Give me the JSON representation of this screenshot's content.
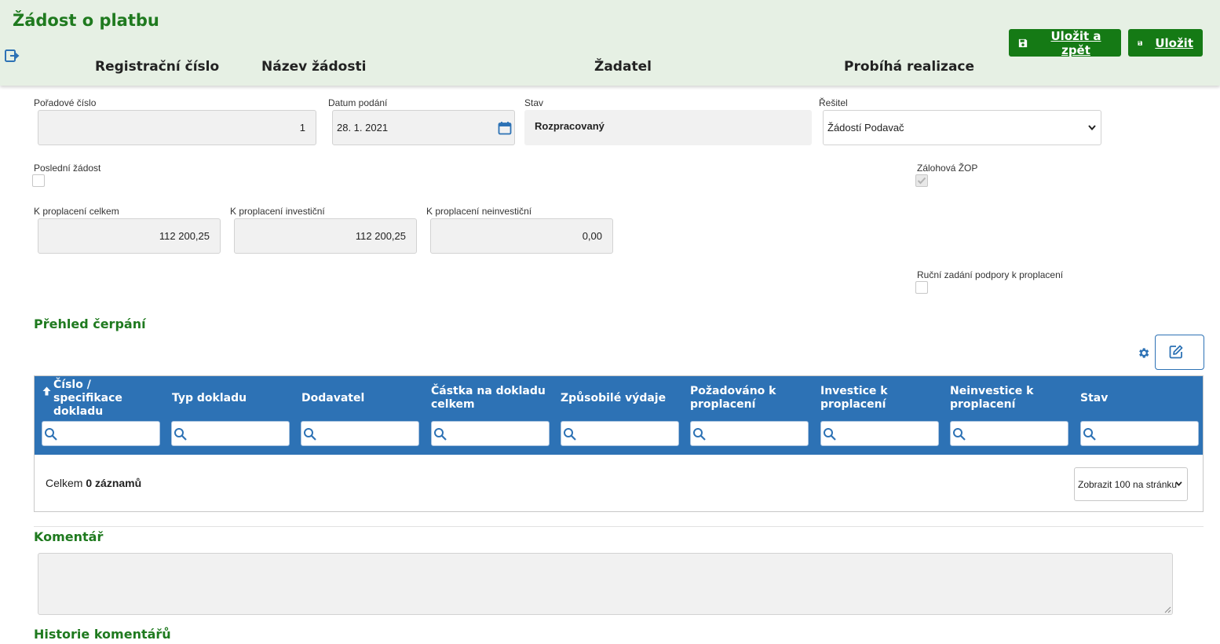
{
  "header": {
    "title": "Žádost o platbu",
    "columns": [
      "Registrační číslo",
      "Název žádosti",
      "Žadatel",
      "Probíhá realizace"
    ],
    "save_back_label": "Uložit a zpět",
    "save_label": "Uložit"
  },
  "form": {
    "poradove_cislo": {
      "label": "Pořadové číslo",
      "value": "1"
    },
    "datum_podani": {
      "label": "Datum podání",
      "value": "28. 1. 2021"
    },
    "stav": {
      "label": "Stav",
      "value": "Rozpracovaný"
    },
    "resitel": {
      "label": "Řešitel",
      "value": "Žádostí Podavač"
    },
    "posledni_zadost": {
      "label": "Poslední žádost",
      "checked": false
    },
    "zalohova_zop": {
      "label": "Zálohová ŽOP",
      "checked": true
    },
    "k_proplaceni_celkem": {
      "label": "K proplacení celkem",
      "value": "112 200,25"
    },
    "k_proplaceni_investicni": {
      "label": "K proplacení investiční",
      "value": "112 200,25"
    },
    "k_proplaceni_neinvesticni": {
      "label": "K proplacení neinvestiční",
      "value": "0,00"
    },
    "rucni_zadani": {
      "label": "Ruční zadání podpory k proplacení",
      "checked": false
    }
  },
  "prehled": {
    "title": "Přehled čerpání",
    "columns": [
      "Číslo / specifikace dokladu",
      "Typ dokladu",
      "Dodavatel",
      "Částka na dokladu celkem",
      "Způsobilé výdaje",
      "Požadováno k proplacení",
      "Investice k proplacení",
      "Neinvestice k proplacení",
      "Stav"
    ],
    "total_prefix": "Celkem",
    "total_count": "0 záznamů",
    "page_size": "Zobrazit 100 na stránku"
  },
  "komentar": {
    "title": "Komentář",
    "value": ""
  },
  "historie": {
    "title": "Historie komentářů"
  },
  "icons": [
    "exit-icon",
    "save-icon",
    "calendar-icon",
    "chevron-down-icon",
    "gear-icon",
    "edit-icon",
    "search-icon",
    "sort-up-icon"
  ],
  "colors": {
    "header_bg": "#e6f0e4",
    "accent_green": "#157a15",
    "title_green": "#1f7a1f",
    "table_header": "#2d72b5"
  }
}
